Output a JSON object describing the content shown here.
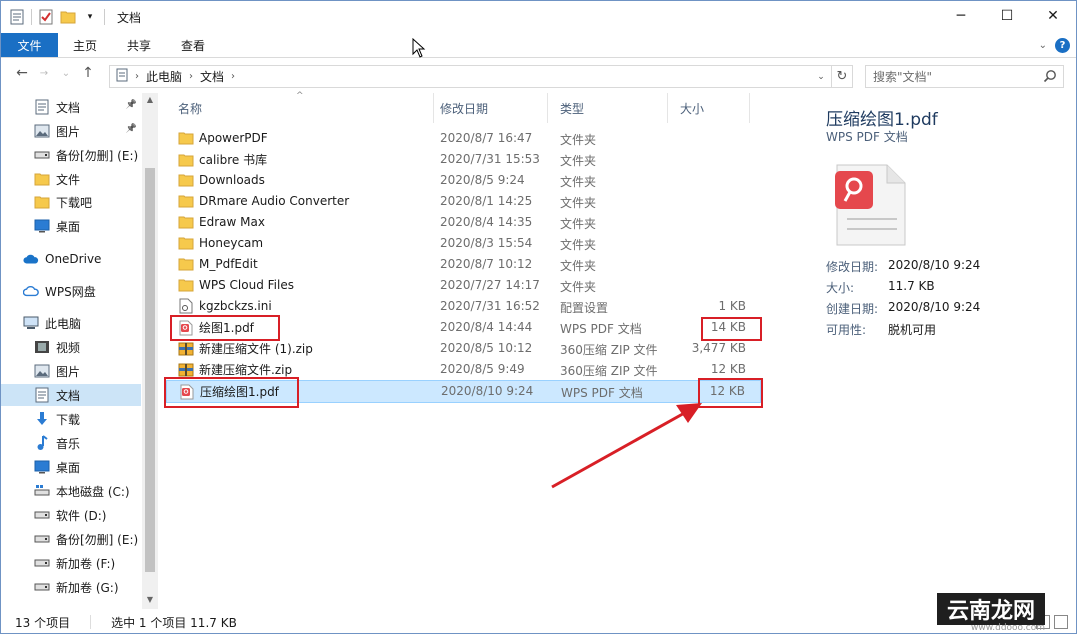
{
  "window": {
    "title": "文档",
    "controls": [
      "minimize",
      "maximize",
      "close"
    ]
  },
  "ribbon": {
    "tabs": [
      "文件",
      "主页",
      "共享",
      "查看"
    ]
  },
  "address": {
    "breadcrumbs": [
      "此电脑",
      "文档"
    ],
    "search_placeholder": "搜索\"文档\""
  },
  "sidebar": {
    "items": [
      {
        "label": "文档",
        "icon": "document-folder-icon",
        "pinned": true
      },
      {
        "label": "图片",
        "icon": "pictures-folder-icon",
        "pinned": true
      },
      {
        "label": "备份[勿删] (E:)",
        "icon": "drive-icon"
      },
      {
        "label": "文件",
        "icon": "folder-icon"
      },
      {
        "label": "下载吧",
        "icon": "folder-icon"
      },
      {
        "label": "桌面",
        "icon": "desktop-icon"
      },
      {
        "label": "OneDrive",
        "icon": "onedrive-icon"
      },
      {
        "label": "WPS网盘",
        "icon": "wps-cloud-icon"
      },
      {
        "label": "此电脑",
        "icon": "computer-icon"
      },
      {
        "label": "视频",
        "icon": "videos-icon"
      },
      {
        "label": "图片",
        "icon": "pictures-folder-icon"
      },
      {
        "label": "文档",
        "icon": "document-folder-icon",
        "selected": true
      },
      {
        "label": "下载",
        "icon": "downloads-icon"
      },
      {
        "label": "音乐",
        "icon": "music-icon"
      },
      {
        "label": "桌面",
        "icon": "desktop-icon"
      },
      {
        "label": "本地磁盘 (C:)",
        "icon": "system-drive-icon"
      },
      {
        "label": "软件 (D:)",
        "icon": "drive-icon"
      },
      {
        "label": "备份[勿删] (E:)",
        "icon": "drive-icon"
      },
      {
        "label": "新加卷 (F:)",
        "icon": "drive-icon"
      },
      {
        "label": "新加卷 (G:)",
        "icon": "drive-icon"
      }
    ]
  },
  "columns": {
    "name": "名称",
    "date": "修改日期",
    "type": "类型",
    "size": "大小"
  },
  "files": [
    {
      "name": "ApowerPDF",
      "date": "2020/8/7 16:47",
      "type": "文件夹",
      "size": "",
      "icon": "folder-icon"
    },
    {
      "name": "calibre 书库",
      "date": "2020/7/31 15:53",
      "type": "文件夹",
      "size": "",
      "icon": "folder-icon"
    },
    {
      "name": "Downloads",
      "date": "2020/8/5 9:24",
      "type": "文件夹",
      "size": "",
      "icon": "folder-icon"
    },
    {
      "name": "DRmare Audio Converter",
      "date": "2020/8/1 14:25",
      "type": "文件夹",
      "size": "",
      "icon": "folder-icon"
    },
    {
      "name": "Edraw Max",
      "date": "2020/8/4 14:35",
      "type": "文件夹",
      "size": "",
      "icon": "folder-icon"
    },
    {
      "name": "Honeycam",
      "date": "2020/8/3 15:54",
      "type": "文件夹",
      "size": "",
      "icon": "folder-icon"
    },
    {
      "name": "M_PdfEdit",
      "date": "2020/8/7 10:12",
      "type": "文件夹",
      "size": "",
      "icon": "folder-icon"
    },
    {
      "name": "WPS Cloud Files",
      "date": "2020/7/27 14:17",
      "type": "文件夹",
      "size": "",
      "icon": "folder-icon"
    },
    {
      "name": "kgzbckzs.ini",
      "date": "2020/7/31 16:52",
      "type": "配置设置",
      "size": "1 KB",
      "icon": "ini-file-icon"
    },
    {
      "name": "绘图1.pdf",
      "date": "2020/8/4 14:44",
      "type": "WPS PDF 文档",
      "size": "14 KB",
      "icon": "pdf-file-icon"
    },
    {
      "name": "新建压缩文件 (1).zip",
      "date": "2020/8/5 10:12",
      "type": "360压缩 ZIP 文件",
      "size": "3,477 KB",
      "icon": "zip-file-icon"
    },
    {
      "name": "新建压缩文件.zip",
      "date": "2020/8/5 9:49",
      "type": "360压缩 ZIP 文件",
      "size": "12 KB",
      "icon": "zip-file-icon"
    },
    {
      "name": "压缩绘图1.pdf",
      "date": "2020/8/10 9:24",
      "type": "WPS PDF 文档",
      "size": "12 KB",
      "icon": "pdf-file-icon",
      "selected": true
    }
  ],
  "preview": {
    "title": "压缩绘图1.pdf",
    "subtitle": "WPS PDF 文档",
    "props": [
      {
        "key": "修改日期:",
        "value": "2020/8/10 9:24"
      },
      {
        "key": "大小:",
        "value": "11.7 KB"
      },
      {
        "key": "创建日期:",
        "value": "2020/8/10 9:24"
      },
      {
        "key": "可用性:",
        "value": "脱机可用"
      }
    ]
  },
  "status": {
    "count": "13 个项目",
    "selection": "选中 1 个项目 11.7 KB"
  },
  "watermark": {
    "text": "云南龙网",
    "sub": "www.ddooo.com"
  },
  "colors": {
    "accent": "#1a6fc4",
    "selection": "#cce8ff",
    "annotation": "#d81f26"
  }
}
